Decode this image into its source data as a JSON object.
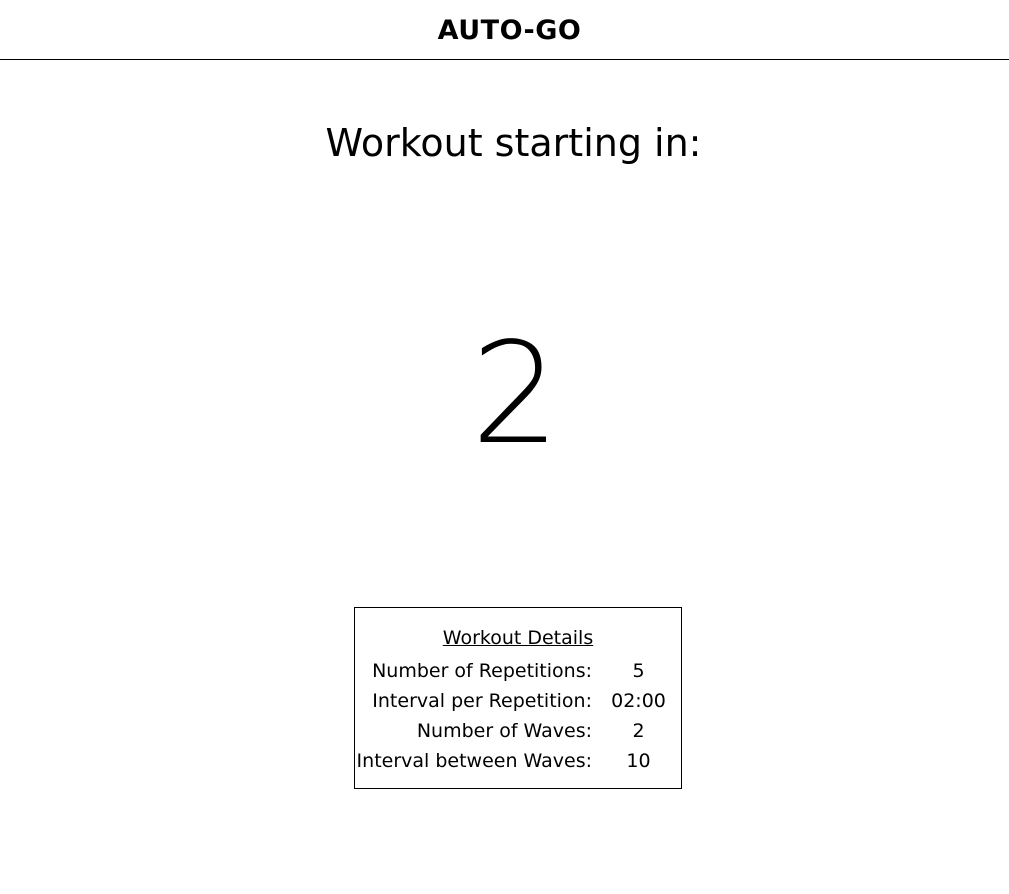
{
  "header": {
    "title": "AUTO-GO"
  },
  "main": {
    "headline": "Workout starting in:",
    "countdown": "2"
  },
  "details": {
    "title": "Workout Details",
    "rows": [
      {
        "label": "Number of Repetitions:",
        "value": "5"
      },
      {
        "label": "Interval per Repetition:",
        "value": "02:00"
      },
      {
        "label": "Number of Waves:",
        "value": "2"
      },
      {
        "label": "Interval between Waves:",
        "value": "10"
      }
    ]
  }
}
